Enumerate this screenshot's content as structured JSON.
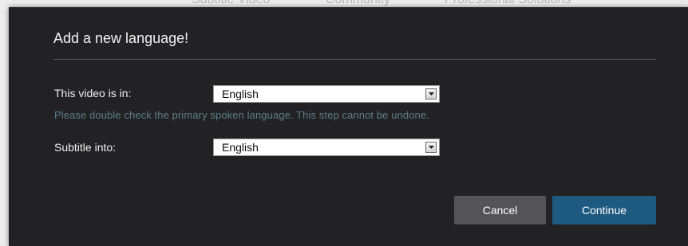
{
  "background": {
    "nav_items": [
      "Subtitle Video",
      "Community",
      "Professional Solutions"
    ]
  },
  "dialog": {
    "title": "Add a new language!",
    "video_language": {
      "label": "This video is in:",
      "selected": "English"
    },
    "hint": "Please double check the primary spoken language. This step cannot be undone.",
    "subtitle_language": {
      "label": "Subtitle into:",
      "selected": "English"
    },
    "cancel_label": "Cancel",
    "continue_label": "Continue"
  },
  "colors": {
    "dialog_background": "#222224",
    "hint_text": "#5d7d87",
    "cancel_button": "#545456",
    "continue_button": "#1e5a80"
  },
  "icons": {
    "select_arrow": "triangle-down-icon"
  }
}
